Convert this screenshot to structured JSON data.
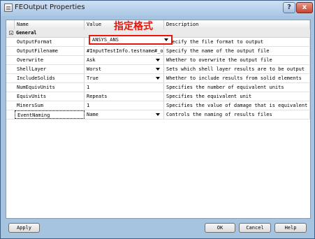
{
  "window": {
    "title": "FEOutput Properties",
    "help_glyph": "?",
    "close_glyph": "x"
  },
  "grid": {
    "columns": [
      "Name",
      "Value",
      "Description"
    ],
    "section": "General",
    "rows": [
      {
        "name": "OutputFormat",
        "value": "ANSYS_ANS",
        "description": "Specify the file format to output",
        "dropdown": true
      },
      {
        "name": "OutputFilename",
        "value": "#InputTestInfo.testname#_out",
        "description": "Specify the name of the output file",
        "dropdown": false
      },
      {
        "name": "Overwrite",
        "value": "Ask",
        "description": "Whether to overwrite the output file",
        "dropdown": true
      },
      {
        "name": "ShellLayer",
        "value": "Worst",
        "description": "Sets which shell layer results are to be output",
        "dropdown": true
      },
      {
        "name": "IncludeSolids",
        "value": "True",
        "description": "Whether to include results from solid elements",
        "dropdown": true
      },
      {
        "name": "NumEquivUnits",
        "value": "1",
        "description": "Specifies the number of equivalent units",
        "dropdown": false
      },
      {
        "name": "EquivUnits",
        "value": "Repeats",
        "description": "Specifies the equivalent unit",
        "dropdown": false
      },
      {
        "name": "MinersSum",
        "value": "1",
        "description": "Specifies the value of damage that is equivalent to f",
        "dropdown": false
      },
      {
        "name": "EventNaming",
        "value": "Name",
        "description": "Controls the naming of results files",
        "dropdown": true
      }
    ]
  },
  "annotation": {
    "text": "指定格式",
    "color": "#e8160b"
  },
  "buttons": {
    "apply": "Apply",
    "ok": "OK",
    "cancel": "Cancel",
    "help": "Help"
  }
}
